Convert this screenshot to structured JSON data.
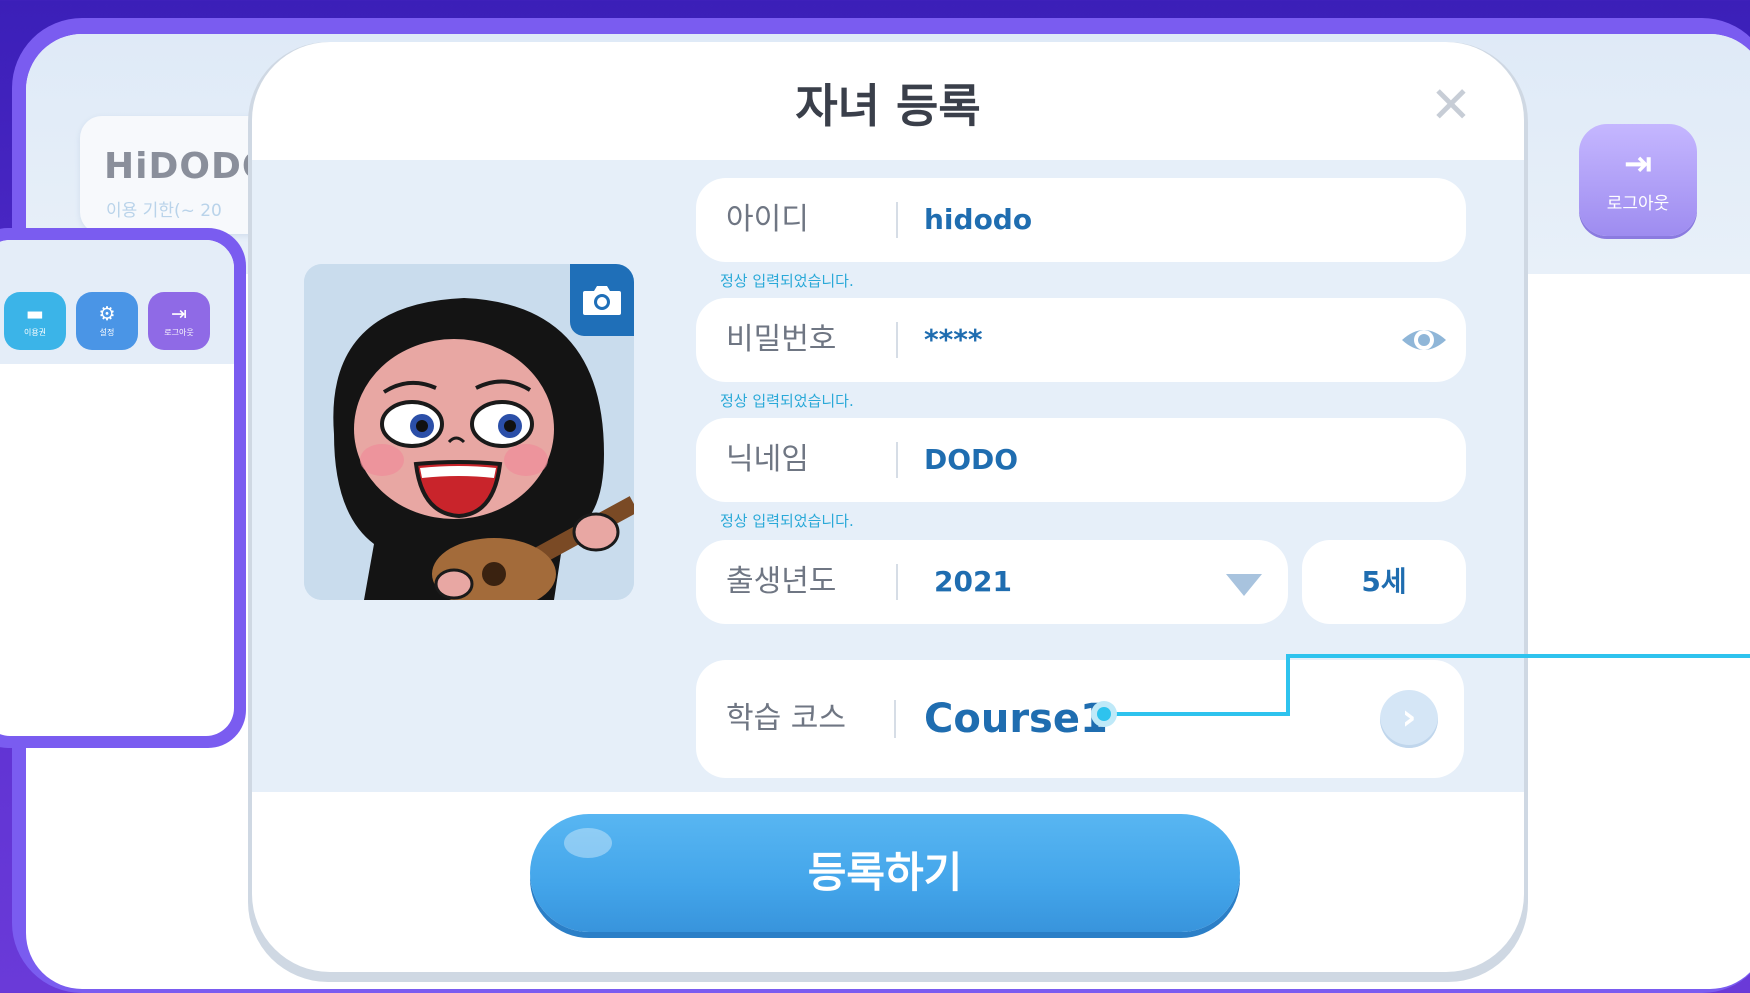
{
  "background_screen": {
    "brand": "HiDODO",
    "expiry": "이용 기한(~ 20",
    "logout_label": "로그아웃"
  },
  "mini_screen": {
    "buttons": [
      {
        "label": "이용권",
        "color": "#3bb4e8"
      },
      {
        "label": "설정",
        "color": "#4a95e6"
      },
      {
        "label": "로그아웃",
        "color": "#8f6ae6"
      }
    ]
  },
  "modal": {
    "title": "자녀 등록",
    "close_icon": "close-icon",
    "avatar": {
      "camera_icon": "camera-icon"
    },
    "fields": {
      "id": {
        "label": "아이디",
        "value": "hidodo",
        "hint": "정상 입력되었습니다."
      },
      "password": {
        "label": "비밀번호",
        "value": "****",
        "hint": "정상 입력되었습니다.",
        "toggle_icon": "eye-icon"
      },
      "nickname": {
        "label": "닉네임",
        "value": "DODO",
        "hint": "정상 입력되었습니다."
      },
      "birth_year": {
        "label": "출생년도",
        "value": "2021",
        "age": "5세"
      },
      "course": {
        "label": "학습 코스",
        "value": "Course1"
      }
    },
    "submit_label": "등록하기"
  },
  "colors": {
    "accent_blue": "#1f6db0",
    "button_blue": "#45a7ea",
    "frame_purple": "#7a5cf0",
    "hint_cyan": "#2aa9d8"
  }
}
